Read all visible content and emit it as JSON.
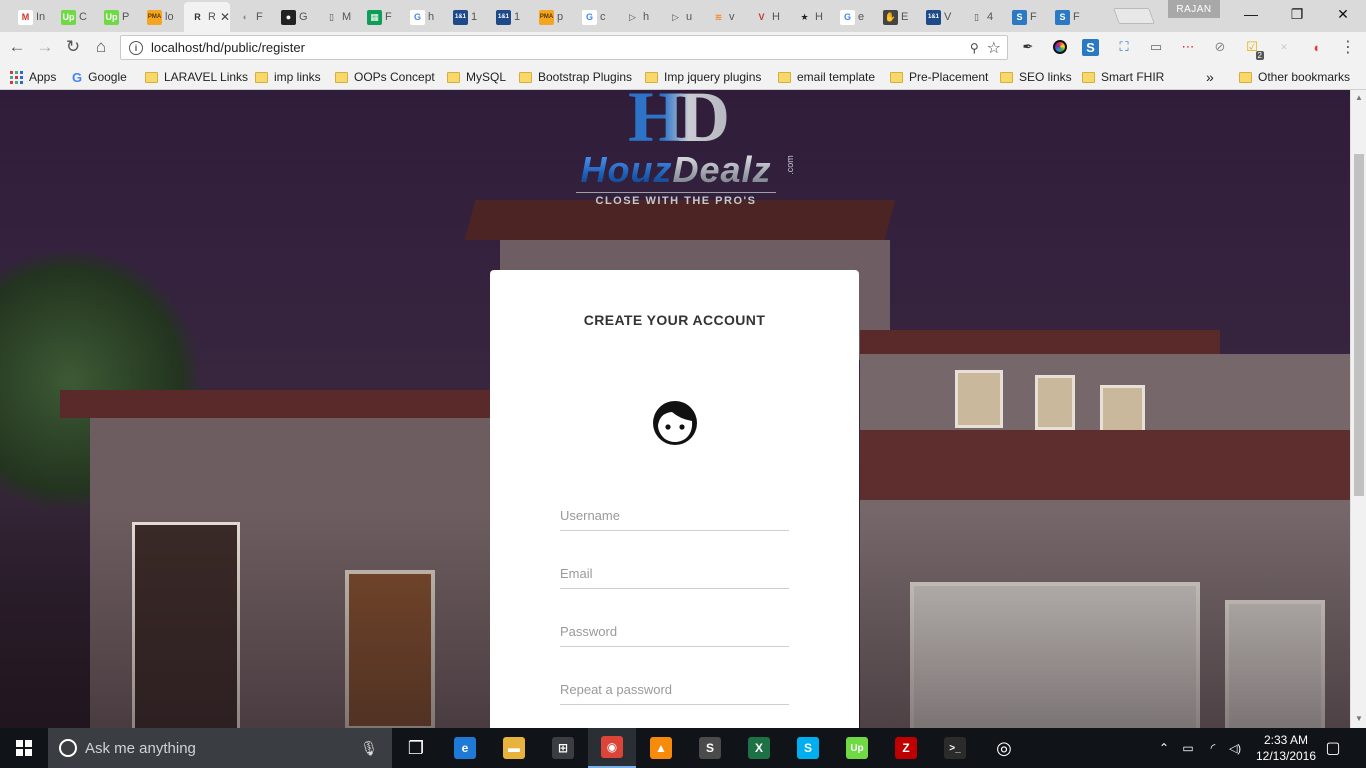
{
  "browser": {
    "tabs": [
      {
        "fav": "M",
        "bg": "#ffffff",
        "fg": "#d93025",
        "title": "In"
      },
      {
        "fav": "Up",
        "bg": "#6fda44",
        "fg": "#ffffff",
        "title": "C"
      },
      {
        "fav": "Up",
        "bg": "#6fda44",
        "fg": "#ffffff",
        "title": "P"
      },
      {
        "fav": "PMA",
        "bg": "#f4a622",
        "fg": "#5a3a00",
        "title": "lo"
      },
      {
        "fav": "R",
        "bg": "#f2f2f2",
        "fg": "#333333",
        "title": "R",
        "active": true
      },
      {
        "fav": "◐",
        "bg": "#dadada",
        "fg": "#888888",
        "title": "F"
      },
      {
        "fav": "●",
        "bg": "#222222",
        "fg": "#ffffff",
        "title": "G"
      },
      {
        "fav": "▯",
        "bg": "#dadada",
        "fg": "#555555",
        "title": "M"
      },
      {
        "fav": "▦",
        "bg": "#0f9d58",
        "fg": "#ffffff",
        "title": "F"
      },
      {
        "fav": "G",
        "bg": "#ffffff",
        "fg": "#4285f4",
        "title": "h"
      },
      {
        "fav": "1&1",
        "bg": "#1e4a8a",
        "fg": "#ffffff",
        "title": "1"
      },
      {
        "fav": "1&1",
        "bg": "#1e4a8a",
        "fg": "#ffffff",
        "title": "1"
      },
      {
        "fav": "PMA",
        "bg": "#f4a622",
        "fg": "#5a3a00",
        "title": "p"
      },
      {
        "fav": "G",
        "bg": "#ffffff",
        "fg": "#4285f4",
        "title": "c"
      },
      {
        "fav": "▷",
        "bg": "#dadada",
        "fg": "#555555",
        "title": "h"
      },
      {
        "fav": "▷",
        "bg": "#dadada",
        "fg": "#555555",
        "title": "u"
      },
      {
        "fav": "≋",
        "bg": "#dadada",
        "fg": "#f48024",
        "title": "v"
      },
      {
        "fav": "V",
        "bg": "#dadada",
        "fg": "#c0392b",
        "title": "H"
      },
      {
        "fav": "★",
        "bg": "#dadada",
        "fg": "#222222",
        "title": "H"
      },
      {
        "fav": "G",
        "bg": "#ffffff",
        "fg": "#4285f4",
        "title": "e"
      },
      {
        "fav": "✋",
        "bg": "#444444",
        "fg": "#ffffff",
        "title": "E"
      },
      {
        "fav": "1&1",
        "bg": "#1e4a8a",
        "fg": "#ffffff",
        "title": "V"
      },
      {
        "fav": "▯",
        "bg": "#dadada",
        "fg": "#555555",
        "title": "4"
      },
      {
        "fav": "S",
        "bg": "#2b79c2",
        "fg": "#ffffff",
        "title": "F"
      },
      {
        "fav": "S",
        "bg": "#2b79c2",
        "fg": "#ffffff",
        "title": "F"
      }
    ],
    "profile_name": "RAJAN",
    "window_controls": {
      "minimize": "—",
      "restore": "❐",
      "close": "✕"
    },
    "nav": {
      "back": "←",
      "forward": "→",
      "reload": "↻",
      "home": "⌂"
    },
    "url": "localhost/hd/public/register",
    "extensions": [
      "eyedropper-icon",
      "color-wheel-icon",
      "s-icon",
      "screen-capture-icon",
      "cast-icon",
      "lastpass-icon",
      "stop-icon",
      "notes-icon",
      "cross-icon",
      "shield-icon",
      "menu-icon"
    ],
    "extension_badge": "2",
    "bookmarks": [
      {
        "label": "Apps",
        "type": "apps"
      },
      {
        "label": "Google",
        "type": "google"
      },
      {
        "label": "LARAVEL Links",
        "type": "folder"
      },
      {
        "label": "imp links",
        "type": "folder"
      },
      {
        "label": "OOPs Concept",
        "type": "folder"
      },
      {
        "label": "MySQL",
        "type": "folder"
      },
      {
        "label": "Bootstrap Plugins",
        "type": "folder"
      },
      {
        "label": "Imp jquery plugins",
        "type": "folder"
      },
      {
        "label": "email template",
        "type": "folder"
      },
      {
        "label": "Pre-Placement",
        "type": "folder"
      },
      {
        "label": "SEO links",
        "type": "folder"
      },
      {
        "label": "Smart FHIR",
        "type": "folder"
      }
    ],
    "bookmarks_overflow": "»",
    "other_bookmarks": "Other bookmarks"
  },
  "page": {
    "logo": {
      "mark": "HD",
      "brand_part1": "Houz",
      "brand_part2": "Dealz",
      "dotcom": ".com",
      "tagline": "CLOSE WITH THE PRO'S"
    },
    "form": {
      "title": "CREATE YOUR ACCOUNT",
      "avatar_icon": "user-face-icon",
      "username_placeholder": "Username",
      "email_placeholder": "Email",
      "password_placeholder": "Password",
      "repeat_password_placeholder": "Repeat a password"
    }
  },
  "taskbar": {
    "search_placeholder": "Ask me anything",
    "apps": [
      {
        "name": "task-view-icon",
        "glyph": "❐",
        "bg": "transparent"
      },
      {
        "name": "edge-icon",
        "glyph": "e",
        "bg": "#1f7ad6"
      },
      {
        "name": "file-explorer-icon",
        "glyph": "▬",
        "bg": "#e8b33c"
      },
      {
        "name": "store-icon",
        "glyph": "⊞",
        "bg": "#3a3d41"
      },
      {
        "name": "chrome-icon",
        "glyph": "◉",
        "bg": "#db4437",
        "active": true
      },
      {
        "name": "vlc-icon",
        "glyph": "▲",
        "bg": "#f58a0b"
      },
      {
        "name": "sublime-text-icon",
        "glyph": "S",
        "bg": "#4b4b4b"
      },
      {
        "name": "excel-icon",
        "glyph": "X",
        "bg": "#1e7145"
      },
      {
        "name": "skype-icon",
        "glyph": "S",
        "bg": "#00aff0"
      },
      {
        "name": "upwork-icon",
        "glyph": "Up",
        "bg": "#6fda44"
      },
      {
        "name": "filezilla-icon",
        "glyph": "Z",
        "bg": "#bf0000"
      },
      {
        "name": "command-prompt-icon",
        "glyph": ">_",
        "bg": "#2b2b2b"
      },
      {
        "name": "app-circle-icon",
        "glyph": "◎",
        "bg": "transparent"
      }
    ],
    "tray": {
      "up_arrow": "⌃",
      "battery": "▭",
      "wifi": "◜",
      "volume": "◁)"
    },
    "time": "2:33 AM",
    "date": "12/13/2016",
    "notification": "▢"
  }
}
